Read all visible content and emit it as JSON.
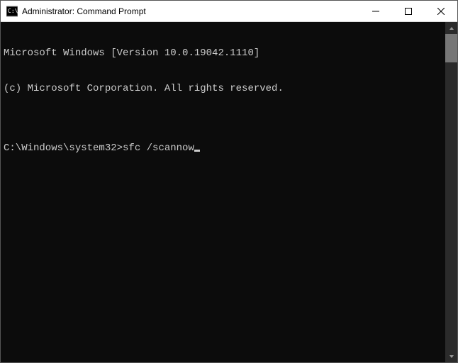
{
  "window": {
    "title": "Administrator: Command Prompt"
  },
  "console": {
    "line1": "Microsoft Windows [Version 10.0.19042.1110]",
    "line2": "(c) Microsoft Corporation. All rights reserved.",
    "blank": "",
    "prompt": "C:\\Windows\\system32>",
    "command": "sfc /scannow"
  }
}
